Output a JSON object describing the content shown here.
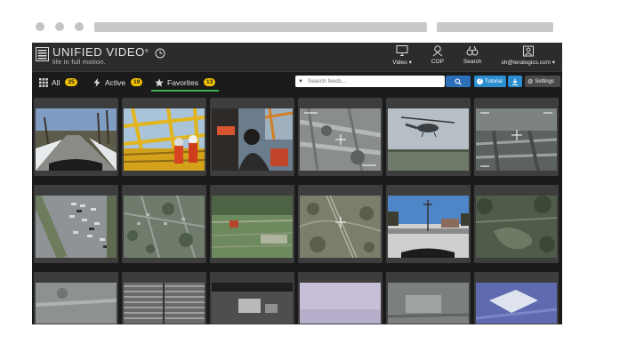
{
  "app": {
    "logo_text": "UNIFIED VIDEO",
    "logo_trademark": "®",
    "tagline": "life in full motion."
  },
  "nav": {
    "video": "Video",
    "cop": "COP",
    "search": "Search",
    "user": "sh@teralogics.com"
  },
  "tabs": {
    "all_label": "All",
    "all_count": "25",
    "active_label": "Active",
    "active_count": "19",
    "favorites_label": "Favorites",
    "favorites_count": "13"
  },
  "toolbar": {
    "search_placeholder": "Search feeds...",
    "tutorial_label": "Tutorial",
    "settings_label": "Settings"
  },
  "colors": {
    "badge": "#f2c200",
    "active_tab_underline": "#43b14e",
    "primary_button": "#2a8ed1"
  },
  "feeds": [
    {
      "scene": "snowy-road"
    },
    {
      "scene": "oil-rig"
    },
    {
      "scene": "helicopter-cockpit"
    },
    {
      "scene": "thermal-aerial"
    },
    {
      "scene": "helicopter-sky"
    },
    {
      "scene": "thermal-night"
    },
    {
      "scene": "parking-lot"
    },
    {
      "scene": "aerial-neighborhood"
    },
    {
      "scene": "aerial-field"
    },
    {
      "scene": "aerial-rail"
    },
    {
      "scene": "street-winter"
    },
    {
      "scene": "aerial-forest"
    },
    {
      "scene": "thermal-grey"
    },
    {
      "scene": "scanlines"
    },
    {
      "scene": "bw-industrial"
    },
    {
      "scene": "lavender-sky"
    },
    {
      "scene": "thermal-building"
    },
    {
      "scene": "aerial-warehouse"
    }
  ]
}
